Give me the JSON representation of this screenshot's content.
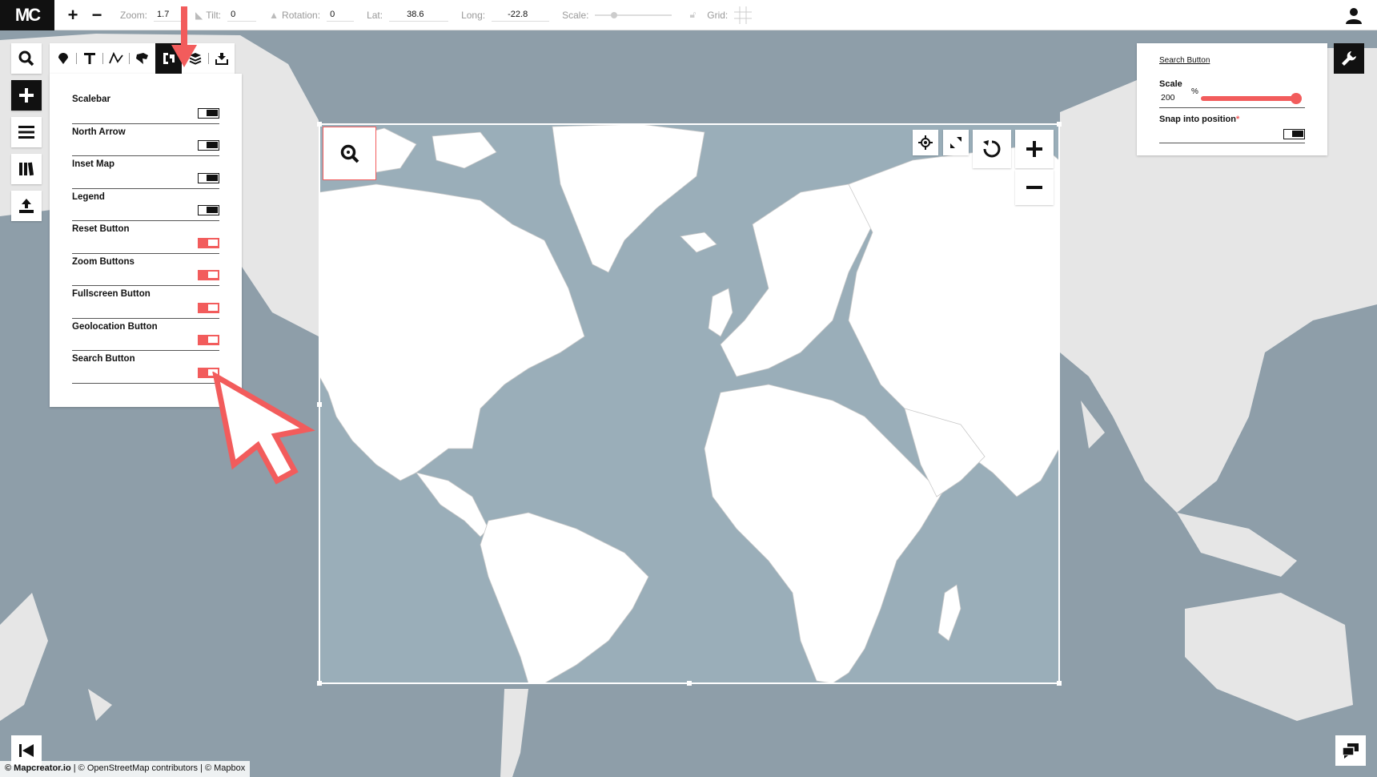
{
  "topbar": {
    "zoom_label": "Zoom:",
    "zoom_value": "1.7",
    "tilt_label": "Tilt:",
    "tilt_value": "0",
    "rotation_label": "Rotation:",
    "rotation_value": "0",
    "lat_label": "Lat:",
    "lat_value": "38.6",
    "long_label": "Long:",
    "long_value": "-22.8",
    "scale_label": "Scale:",
    "grid_label": "Grid:"
  },
  "logo": "MC",
  "panel": {
    "items": [
      {
        "label": "Scalebar",
        "on": false
      },
      {
        "label": "North Arrow",
        "on": false
      },
      {
        "label": "Inset Map",
        "on": false
      },
      {
        "label": "Legend",
        "on": false
      },
      {
        "label": "Reset Button",
        "on": true
      },
      {
        "label": "Zoom Buttons",
        "on": true
      },
      {
        "label": "Fullscreen Button",
        "on": true
      },
      {
        "label": "Geolocation Button",
        "on": true
      },
      {
        "label": "Search Button",
        "on": true
      }
    ]
  },
  "config": {
    "title": "Search Button",
    "scale_label": "Scale",
    "scale_value": "200",
    "scale_unit": "%",
    "snap_label": "Snap into position",
    "snap_required": "*"
  },
  "footer": {
    "brand": "© Mapcreator.io",
    "credits": " | © OpenStreetMap contributors | © Mapbox"
  },
  "colors": {
    "accent": "#f25c5c",
    "water": "#8e9ea9",
    "land": "#ffffff",
    "land_outside": "#e4e4e4"
  }
}
